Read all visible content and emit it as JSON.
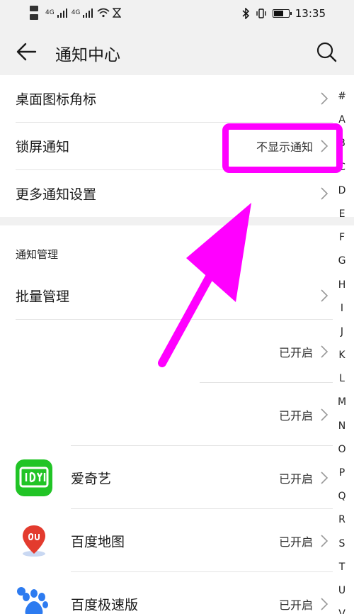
{
  "status_bar": {
    "network_label": "4G",
    "time": "13:35",
    "battery_percent": 70
  },
  "header": {
    "title": "通知中心",
    "back_icon": "arrow-left-icon",
    "search_icon": "search-icon"
  },
  "settings": [
    {
      "label": "桌面图标角标",
      "value": ""
    },
    {
      "label": "锁屏通知",
      "value": "不显示通知"
    },
    {
      "label": "更多通知设置",
      "value": ""
    }
  ],
  "manage": {
    "section_title": "通知管理",
    "batch_label": "批量管理"
  },
  "apps": [
    {
      "name": "",
      "status": "已开启"
    },
    {
      "name": "",
      "status": "已开启"
    },
    {
      "name": "爱奇艺",
      "status": "已开启"
    },
    {
      "name": "百度地图",
      "status": "已开启"
    },
    {
      "name": "百度极速版",
      "status": "已开启"
    }
  ],
  "alpha_index": [
    "#",
    "A",
    "B",
    "C",
    "D",
    "E",
    "F",
    "G",
    "H",
    "I",
    "J",
    "K",
    "L",
    "M",
    "N",
    "O",
    "P",
    "Q",
    "R",
    "S",
    "T",
    "U",
    "V"
  ],
  "colors": {
    "highlight": "#ff00ff",
    "iqiyi_green": "#21c426",
    "baidu_blue": "#2d7bf0",
    "baidu_red": "#e33b2e"
  }
}
